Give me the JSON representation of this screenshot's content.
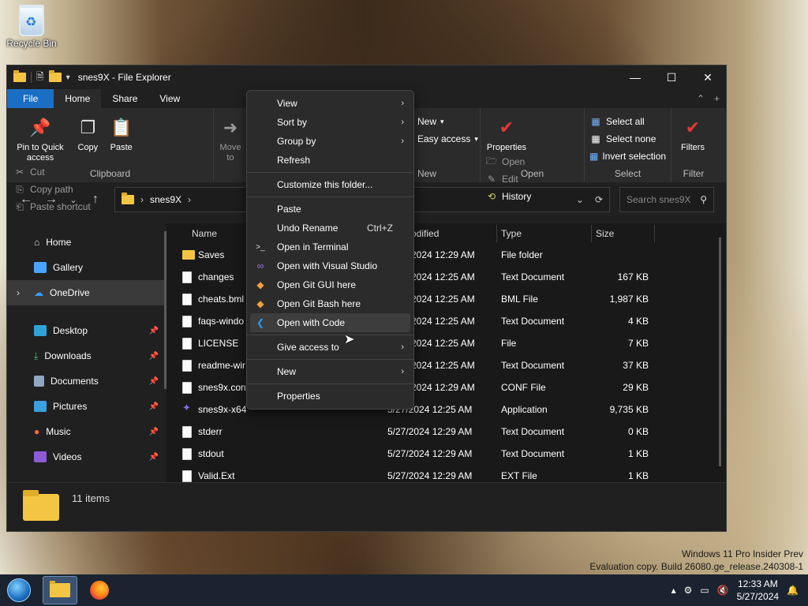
{
  "desktop": {
    "recycle_bin": "Recycle Bin"
  },
  "window": {
    "title": "snes9X - File Explorer",
    "controls": {
      "minimize": "—",
      "maximize": "☐",
      "close": "✕"
    }
  },
  "tabs": {
    "file": "File",
    "home": "Home",
    "share": "Share",
    "view": "View"
  },
  "ribbon": {
    "clipboard": {
      "name": "Clipboard",
      "pin": "Pin to Quick access",
      "copy": "Copy",
      "paste": "Paste",
      "cut": "Cut",
      "copy_path": "Copy path",
      "paste_shortcut": "Paste shortcut"
    },
    "organize": {
      "move_to": "Move to"
    },
    "new": {
      "name": "New",
      "new_item": "New",
      "easy_access": "Easy access"
    },
    "open": {
      "name": "Open",
      "properties": "Properties",
      "open": "Open",
      "edit": "Edit",
      "history": "History"
    },
    "select": {
      "name": "Select",
      "select_all": "Select all",
      "select_none": "Select none",
      "invert": "Invert selection"
    },
    "filter": {
      "name": "Filter",
      "filters": "Filters"
    }
  },
  "address": {
    "path": "snes9X",
    "search_placeholder": "Search snes9X"
  },
  "nav": {
    "home": "Home",
    "gallery": "Gallery",
    "onedrive": "OneDrive",
    "desktop": "Desktop",
    "downloads": "Downloads",
    "documents": "Documents",
    "pictures": "Pictures",
    "music": "Music",
    "videos": "Videos"
  },
  "columns": {
    "name": "Name",
    "modified": "odified",
    "type": "Type",
    "size": "Size"
  },
  "files": [
    {
      "name": "Saves",
      "date": "2024 12:29 AM",
      "type": "File folder",
      "size": ""
    },
    {
      "name": "changes",
      "date": "2024 12:25 AM",
      "type": "Text Document",
      "size": "167 KB"
    },
    {
      "name": "cheats.bml",
      "date": "2024 12:25 AM",
      "type": "BML File",
      "size": "1,987 KB"
    },
    {
      "name": "faqs-windo",
      "date": "2024 12:25 AM",
      "type": "Text Document",
      "size": "4 KB"
    },
    {
      "name": "LICENSE",
      "date": "2024 12:25 AM",
      "type": "File",
      "size": "7 KB"
    },
    {
      "name": "readme-wir",
      "date": "2024 12:25 AM",
      "type": "Text Document",
      "size": "37 KB"
    },
    {
      "name": "snes9x.conf",
      "date": "2024 12:29 AM",
      "type": "CONF File",
      "size": "29 KB"
    },
    {
      "name": "snes9x-x64",
      "date": "5/27/2024 12:25 AM",
      "type": "Application",
      "size": "9,735 KB"
    },
    {
      "name": "stderr",
      "date": "5/27/2024 12:29 AM",
      "type": "Text Document",
      "size": "0 KB"
    },
    {
      "name": "stdout",
      "date": "5/27/2024 12:29 AM",
      "type": "Text Document",
      "size": "1 KB"
    },
    {
      "name": "Valid.Ext",
      "date": "5/27/2024 12:29 AM",
      "type": "EXT File",
      "size": "1 KB"
    }
  ],
  "status": {
    "items": "11 items"
  },
  "context_menu": {
    "view": "View",
    "sort_by": "Sort by",
    "group_by": "Group by",
    "refresh": "Refresh",
    "customize": "Customize this folder...",
    "paste": "Paste",
    "undo_rename": "Undo Rename",
    "undo_shortcut": "Ctrl+Z",
    "open_terminal": "Open in Terminal",
    "open_vs": "Open with Visual Studio",
    "git_gui": "Open Git GUI here",
    "git_bash": "Open Git Bash here",
    "open_code": "Open with Code",
    "give_access": "Give access to",
    "new": "New",
    "properties": "Properties"
  },
  "watermark": {
    "line1": "Windows 11 Pro Insider Prev",
    "line2": "Evaluation copy. Build 26080.ge_release.240308-1"
  },
  "taskbar": {
    "time": "12:33 AM",
    "date": "5/27/2024"
  }
}
